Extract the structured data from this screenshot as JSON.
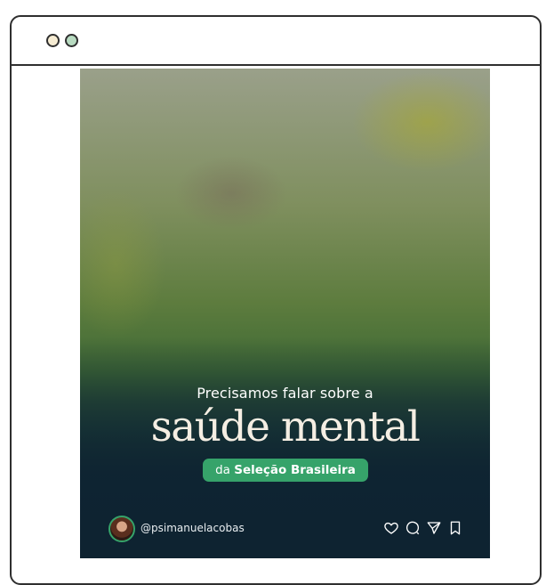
{
  "window": {
    "controls": [
      "window-dot-icon",
      "window-dot-icon"
    ]
  },
  "post": {
    "kicker": "Precisamos falar sobre a",
    "headline": "saúde mental",
    "pill_prefix": "da",
    "pill_emphasis": "Seleção Brasileira",
    "handle": "@psimanuelacobas",
    "actions": [
      "heart-icon",
      "comment-icon",
      "send-icon",
      "bookmark-icon"
    ]
  },
  "colors": {
    "accent": "#36a36a",
    "background": "#0e2331",
    "headline": "#f5eee3"
  }
}
